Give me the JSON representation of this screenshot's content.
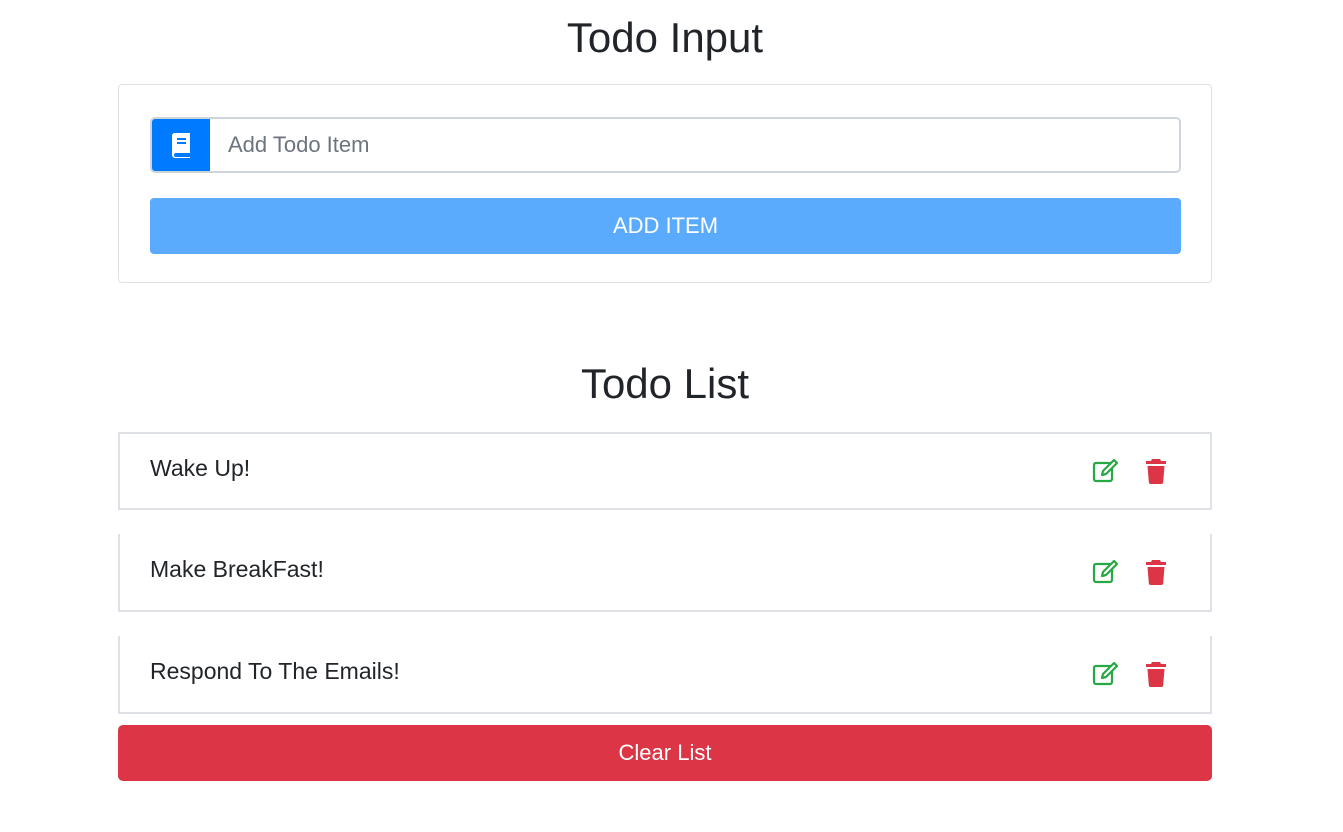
{
  "input_section": {
    "title": "Todo Input",
    "input_placeholder": "Add Todo Item",
    "input_value": "",
    "prefix_icon": "book-icon",
    "add_button_label": "Add Item"
  },
  "list_section": {
    "title": "Todo List",
    "items": [
      {
        "text": "Wake Up!",
        "edit_icon": "edit-icon",
        "delete_icon": "trash-icon"
      },
      {
        "text": "Make BreakFast!",
        "edit_icon": "edit-icon",
        "delete_icon": "trash-icon"
      },
      {
        "text": "Respond To The Emails!",
        "edit_icon": "edit-icon",
        "delete_icon": "trash-icon"
      }
    ],
    "clear_button_label": "Clear List"
  },
  "colors": {
    "primary": "#007bff",
    "add_button": "#5aabfd",
    "danger": "#dc3545",
    "success": "#28a745",
    "text": "#212529",
    "border": "#dee2e6"
  }
}
